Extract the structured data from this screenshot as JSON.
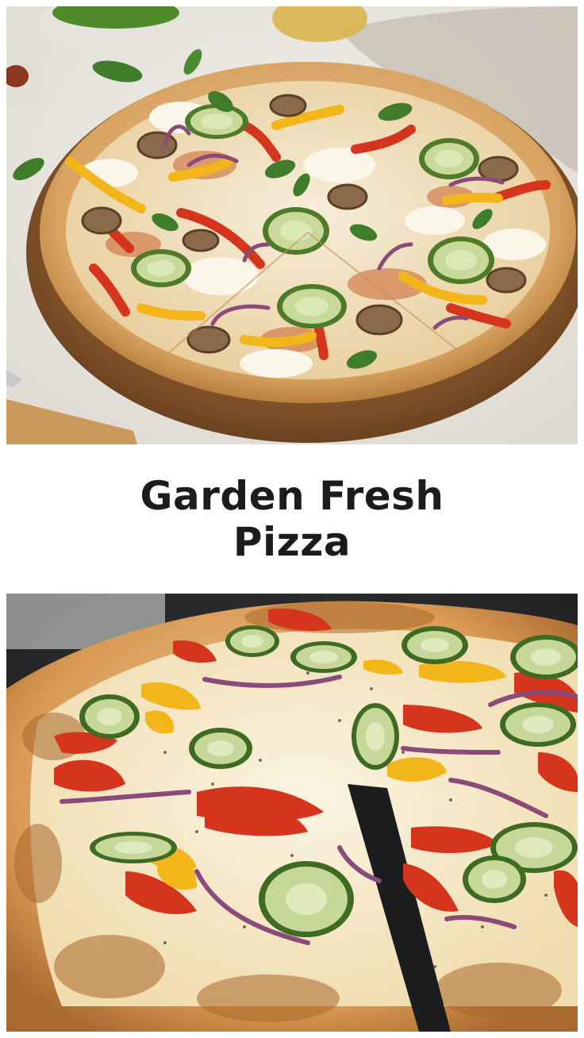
{
  "pin": {
    "title_line_1": "Garden Fresh",
    "title_line_2": "Pizza"
  },
  "images": {
    "top": {
      "subject": "whole-veggie-pizza-on-wooden-board"
    },
    "bottom": {
      "subject": "sliced-veggie-pizza-on-dark-pan"
    }
  },
  "colors": {
    "background": "#ffffff",
    "title_text": "#1c1c1c",
    "crust": "#d9a566",
    "cheese": "#f3ead2",
    "red_pepper": "#d4351c",
    "yellow_pepper": "#f2b51a",
    "zucchini": "#6d9b3a",
    "red_onion": "#8a4a7a",
    "mushroom": "#8a6a4a",
    "basil": "#3f7d2a",
    "board": "#8a5a2e",
    "pan": "#2a2b2d"
  }
}
